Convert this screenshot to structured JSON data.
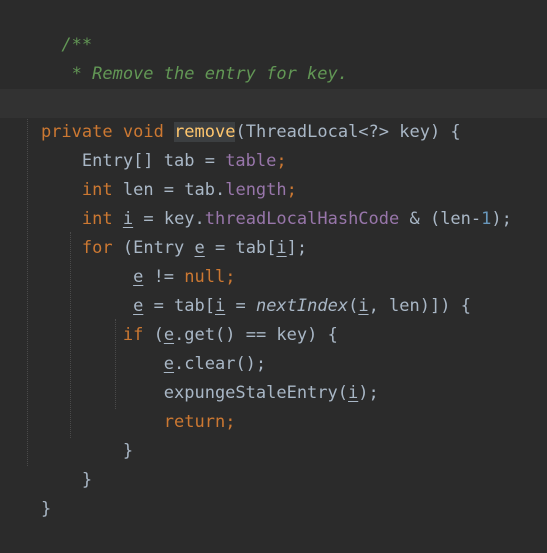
{
  "code": {
    "lines": [
      [
        "  /**"
      ],
      [
        "   * Remove the entry for key."
      ],
      [
        "   */"
      ],
      [
        "private",
        " ",
        "void",
        " ",
        "remove",
        "(ThreadLocal<?> key) {"
      ],
      [
        "    Entry[] tab = ",
        "table",
        ";"
      ],
      [
        "    ",
        "int",
        " len = tab.",
        "length",
        ";"
      ],
      [
        "    ",
        "int",
        " ",
        "i",
        " = key.",
        "threadLocalHashCode",
        " & (len-",
        "1",
        ");"
      ],
      [
        "    ",
        "for",
        " (Entry ",
        "e",
        " = tab[",
        "i",
        "];"
      ],
      [
        "         ",
        "e",
        " != ",
        "null",
        ";"
      ],
      [
        "         ",
        "e",
        " = tab[",
        "i",
        " = ",
        "nextIndex",
        "(",
        "i",
        ", len)]) {"
      ],
      [
        "        ",
        "if",
        " (",
        "e",
        ".get() == key) {"
      ],
      [
        "            ",
        "e",
        ".clear();"
      ],
      [
        "            expungeStaleEntry(",
        "i",
        ");"
      ],
      [
        "            ",
        "return",
        ";"
      ],
      [
        "        }"
      ],
      [
        "    }"
      ],
      [
        "}"
      ]
    ]
  },
  "colors": {
    "background": "#2b2b2b",
    "keyword": "#cc7832",
    "comment": "#629755",
    "field": "#9876aa",
    "method_declaration": "#ffc66d",
    "number": "#6897bb",
    "default_text": "#a9b7c6"
  }
}
